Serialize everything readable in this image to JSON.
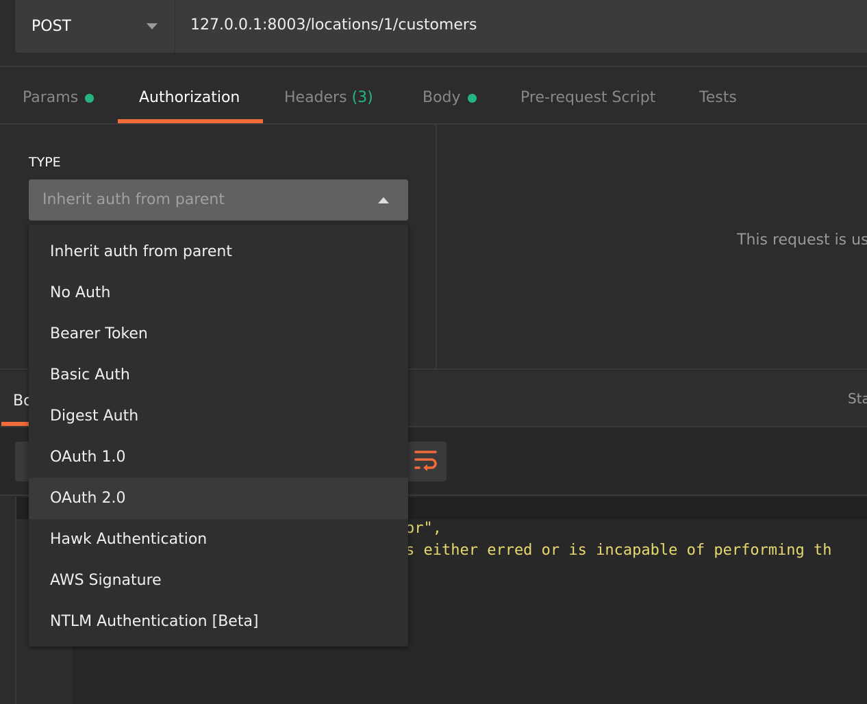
{
  "request": {
    "method": "POST",
    "url": "127.0.0.1:8003/locations/1/customers"
  },
  "tabs": [
    {
      "label": "Params",
      "dot": true
    },
    {
      "label": "Authorization",
      "active": true
    },
    {
      "label": "Headers",
      "count": "(3)"
    },
    {
      "label": "Body",
      "dot": true
    },
    {
      "label": "Pre-request Script"
    },
    {
      "label": "Tests"
    }
  ],
  "auth": {
    "type_label": "TYPE",
    "selected": "Inherit auth from parent",
    "message": "This request is us",
    "options": [
      "Inherit auth from parent",
      "No Auth",
      "Bearer Token",
      "Basic Auth",
      "Digest Auth",
      "OAuth 1.0",
      "OAuth 2.0",
      "Hawk Authentication",
      "AWS Signature",
      "NTLM Authentication [Beta]"
    ],
    "hovered": "OAuth 2.0"
  },
  "response": {
    "tab_label": "Bo",
    "status_label": "Sta",
    "code_lines": [
      "or\",",
      "s either erred or is incapable of performing th"
    ]
  },
  "colors": {
    "accent": "#f26b3a",
    "green": "#26b47f",
    "code": "#e6d96f"
  }
}
